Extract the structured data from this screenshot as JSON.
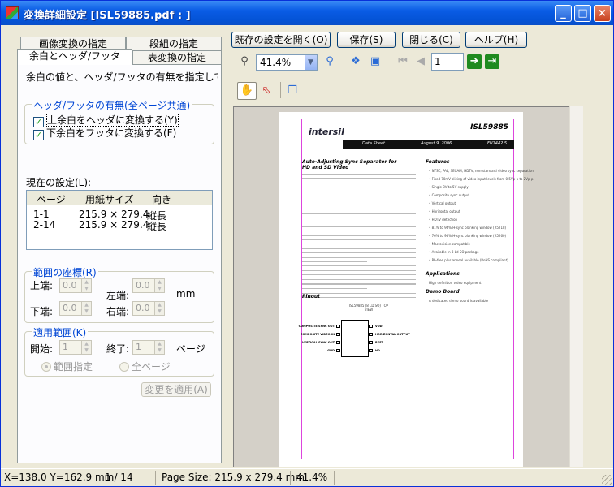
{
  "window": {
    "title": "変換詳細設定 [ISL59885.pdf : ]",
    "minimize": "_",
    "maximize": "□",
    "close": "×"
  },
  "tabs": {
    "row1": [
      "画像変換の指定",
      "段組の指定"
    ],
    "row2": [
      "余白とヘッダ/フッタ",
      "表変換の指定"
    ]
  },
  "panel": {
    "description": "余白の値と、ヘッダ/フッタの有無を指定してください。",
    "header_group": {
      "title": "ヘッダ/フッタの有無(全ページ共通)",
      "check1": "上余白をヘッダに変換する(Y)",
      "check2": "下余白をフッタに変換する(F)"
    },
    "current_settings_label": "現在の設定(L):",
    "list": {
      "columns": [
        "ページ",
        "用紙サイズ",
        "向き"
      ],
      "rows": [
        [
          "1-1",
          "215.9 × 279.4",
          "縦長"
        ],
        [
          "2-14",
          "215.9 × 279.4",
          "縦長"
        ]
      ]
    },
    "range_coords": {
      "title": "範囲の座標(R)",
      "top": "上端:",
      "left": "左端:",
      "bottom": "下端:",
      "right": "右端:",
      "value": "0.0",
      "unit": "mm"
    },
    "apply_range": {
      "title": "適用範囲(K)",
      "start": "開始:",
      "end": "終了:",
      "start_value": "1",
      "end_value": "1",
      "unit": "ページ",
      "radio1": "範囲指定",
      "radio2": "全ページ"
    },
    "apply_button": "変更を適用(A)"
  },
  "toolbar": {
    "open_settings": "既存の設定を開く(O)",
    "save": "保存(S)",
    "close": "閉じる(C)",
    "help": "ヘルプ(H)",
    "zoom": "41.4%",
    "page": "1"
  },
  "pdf": {
    "logo": "intersil",
    "part": "ISL59885",
    "bar_left": "Data Sheet",
    "bar_mid": "August 9, 2006",
    "bar_right": "FN7442.5",
    "heading_main": "Auto-Adjusting Sync Separator for HD and SD Video",
    "features": "Features",
    "applications": "Applications",
    "demo_board": "Demo Board",
    "pinout": "Pinout",
    "feature_items": [
      "NTSC, PAL, SECAM, HDTV, non-standard video sync separation",
      "Fixed 70mV slicing of video input levels from 0.5Vp-p to 2Vp-p",
      "Single 3V to 5V supply",
      "Composite sync output",
      "Vertical output",
      "Horizontal output",
      "HDTV detection",
      "81% to 96% H-sync blanking window (R5218)",
      "76% to 96% H-sync blanking window (R5260)",
      "Macrovision compatible",
      "Available in 8 Ld SO package",
      "Pb-free plus anneal available (RoHS compliant)"
    ],
    "application_items": [
      "High definition video equipment"
    ],
    "demo_items": [
      "A dedicated demo board is available"
    ],
    "pins_left": [
      "COMPOSITE SYNC OUT",
      "COMPOSITE VIDEO IN",
      "VERTICAL SYNC OUT",
      "GND"
    ],
    "pins_right": [
      "VDD",
      "HORIZONTAL OUTPUT",
      "RSET",
      "HD"
    ],
    "chip_label": "ISL59885 (8 LD SO) TOP VIEW"
  },
  "status": {
    "coords": "X=138.0 Y=162.9 mm",
    "page": "1 / 14",
    "page_size": "Page Size: 215.9 x 279.4 mm",
    "zoom": "41.4%"
  }
}
